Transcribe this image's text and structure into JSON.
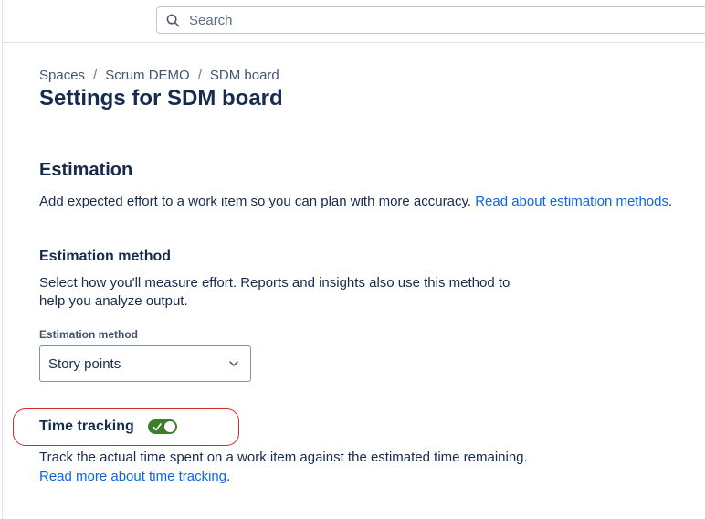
{
  "topbar": {
    "search_placeholder": "Search"
  },
  "breadcrumbs": [
    "Spaces",
    "Scrum DEMO",
    "SDM board"
  ],
  "page_title": "Settings for SDM board",
  "estimation": {
    "title": "Estimation",
    "description": "Add expected effort to a work item so you can plan with more accuracy.",
    "link": "Read about estimation methods",
    "link_suffix": "."
  },
  "estimation_method": {
    "title": "Estimation method",
    "description": "Select how you'll measure effort. Reports and insights also use this method to help you analyze output.",
    "field_label": "Estimation method",
    "selected_value": "Story points"
  },
  "time_tracking": {
    "title": "Time tracking",
    "enabled": true,
    "description": "Track the actual time spent on a work item against the estimated time remaining.",
    "link": "Read more about time tracking",
    "link_suffix": "."
  },
  "colors": {
    "link": "#0c66e4",
    "toggle_on": "#3e7d2c",
    "highlight": "#d62b2b",
    "text": "#172b4d"
  },
  "icons": {
    "search": "search-icon",
    "dropdown": "chevron-down-icon",
    "toggle_check": "check-icon"
  }
}
